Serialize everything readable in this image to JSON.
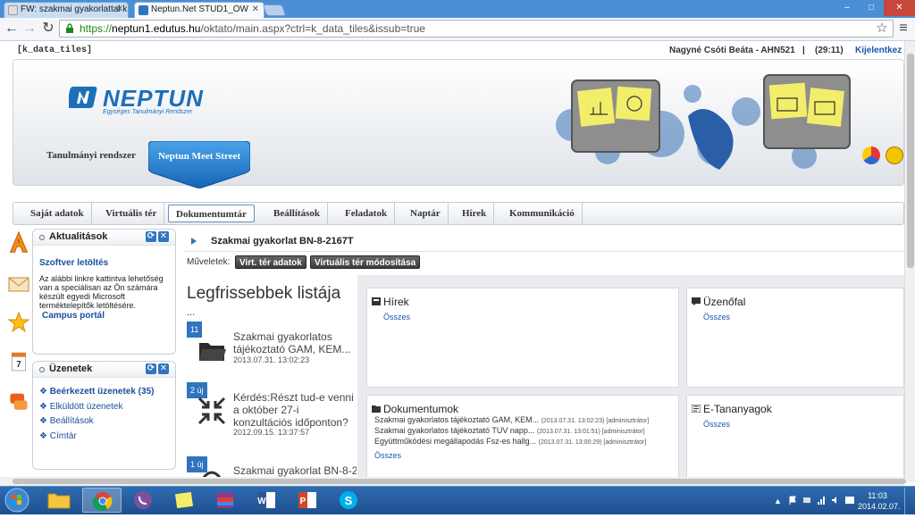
{
  "browser": {
    "tabs": [
      {
        "label": "FW: szakmai gyakorlattal k",
        "active": false
      },
      {
        "label": "Neptun.Net STUD1_OW",
        "active": true
      }
    ],
    "window_controls": {
      "minimize": "–",
      "maximize": "□",
      "close": "✕"
    },
    "nav": {
      "back": "←",
      "forward": "→",
      "reload": "↻"
    },
    "url": {
      "scheme": "https://",
      "host": "neptun1.edutus.hu",
      "path": "/oktato/main.aspx?ctrl=k_data_tiles&issub=true"
    },
    "star": "☆",
    "menu": "≡"
  },
  "topbar": {
    "ctrl": "[k_data_tiles]",
    "user": "Nagyné Csóti Beáta - AHN521",
    "separator": "|",
    "session": "(29:11)",
    "logout": "Kijelentkez"
  },
  "header": {
    "logo_text": "NEPTUN",
    "logo_sub": "Egységes Tanulmányi Rendszer",
    "system_name": "Tanulmányi rendszer",
    "meet_street": "Neptun Meet Street"
  },
  "menu": [
    {
      "label": "Saját adatok"
    },
    {
      "label": "Virtuális tér"
    },
    {
      "label": "Dokumentumtár",
      "selected": true
    },
    {
      "label": "Beállítások"
    },
    {
      "label": "Feladatok"
    },
    {
      "label": "Naptár"
    },
    {
      "label": "Hírek"
    },
    {
      "label": "Kommunikáció"
    }
  ],
  "left_panels": {
    "news": {
      "title": "Aktualitások",
      "item_title": "Szoftver letöltés",
      "item_text": "Az alábbi linkre kattintva lehetőség van a speciálisan az Ön számára készült egyedi Microsoft terméktelepítők letöltésére.",
      "item_link": "Campus portál"
    },
    "messages": {
      "title": "Üzenetek",
      "items": [
        "Beérkezett üzenetek (35)",
        "Elküldött üzenetek",
        "Beállítások",
        "Címtár"
      ]
    }
  },
  "content": {
    "course_title": "Szakmai gyakorlat BN-8-2167T",
    "ops_label": "Műveletek:",
    "ops": [
      "Virt. tér adatok",
      "Virtuális tér módosítása"
    ],
    "latest_title": "Legfrissebbek listája",
    "latest_ellipsis": "...",
    "feed": [
      {
        "badge": "11",
        "title": "Szakmai gyakorlatos tájékoztató GAM, KEM...",
        "date": "2013.07.31. 13:02:23",
        "icon": "folder-icon"
      },
      {
        "badge": "2 új",
        "title": "Kérdés:Részt tud-e venni a október 27-i konzultációs időponton?",
        "date": "2012.09.15. 13:37:57",
        "icon": "collapse-arrows-icon"
      },
      {
        "badge": "1 új",
        "title": "Szakmai gyakorlat BN-8-2",
        "date": "",
        "icon": "user-icon"
      }
    ]
  },
  "widgets": {
    "news": {
      "title": "Hírek",
      "link": "Összes"
    },
    "wall": {
      "title": "Üzenőfal",
      "link": "Összes"
    },
    "docs": {
      "title": "Dokumentumok",
      "rows": [
        {
          "name": "Szakmai gyakorlatos tájékoztató GAM, KEM...",
          "meta": "(2013.07.31. 13:02:23) [adminisztrátor]"
        },
        {
          "name": "Szakmai gyakorlatos tájékoztató TUV napp...",
          "meta": "(2013.07.31. 13:01:51) [adminisztrátor]"
        },
        {
          "name": "Együttműködési megállapodás Fsz-es hallg...",
          "meta": "(2013.07.31. 13:00:29) [adminisztrátor]"
        }
      ],
      "link": "Összes"
    },
    "elearning": {
      "title": "E-Tananyagok",
      "link": "Összes"
    }
  },
  "taskbar": {
    "clock_time": "11:03",
    "clock_date": "2014.02.07."
  },
  "colors": {
    "accent": "#2f74c0",
    "link": "#1a4f9c",
    "taskbar": "#1e4f8f"
  }
}
